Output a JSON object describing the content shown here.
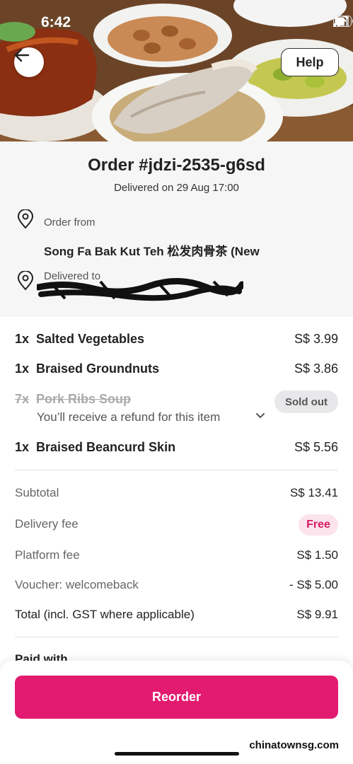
{
  "status_bar": {
    "time": "6:42"
  },
  "header": {
    "help_label": "Help"
  },
  "order": {
    "title": "Order #jdzi-2535-g6sd",
    "delivered_line": "Delivered on 29 Aug 17:00",
    "from_label": "Order from",
    "restaurant": "Song Fa Bak Kut Teh 松发肉骨茶 (New",
    "to_label": "Delivered to"
  },
  "items": [
    {
      "qty": "1x",
      "name": "Salted Vegetables",
      "price": "S$ 3.99"
    },
    {
      "qty": "1x",
      "name": "Braised Groundnuts",
      "price": "S$ 3.86"
    },
    {
      "qty": "7x",
      "name": "Pork Ribs Soup",
      "badge": "Sold out",
      "note": "You’ll receive a refund for this item"
    },
    {
      "qty": "1x",
      "name": "Braised Beancurd Skin",
      "price": "S$ 5.56"
    }
  ],
  "totals": {
    "subtotal_label": "Subtotal",
    "subtotal": "S$ 13.41",
    "delivery_label": "Delivery fee",
    "delivery": "Free",
    "platform_label": "Platform fee",
    "platform": "S$ 1.50",
    "voucher_label": "Voucher: welcomeback",
    "voucher": "- S$ 5.00",
    "total_label": "Total (incl. GST where applicable)",
    "total": "S$ 9.91"
  },
  "payment": {
    "label": "Paid with"
  },
  "actions": {
    "reorder": "Reorder"
  },
  "watermark": "chinatownsg.com",
  "colors": {
    "brand": "#e21b70",
    "free_bg": "#fce4ec",
    "free_text": "#d81b60"
  }
}
